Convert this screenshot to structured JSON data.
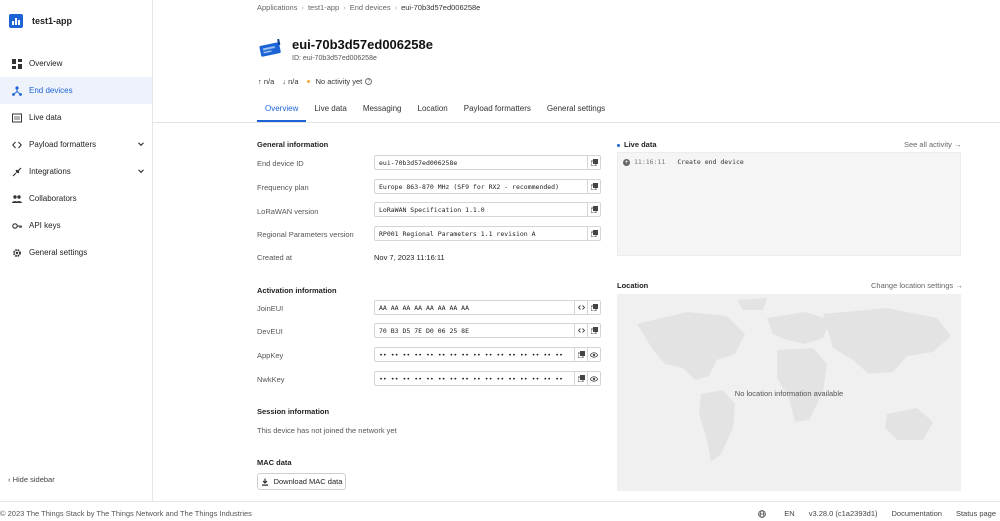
{
  "app": {
    "name": "test1-app"
  },
  "sidebar": {
    "items": [
      {
        "label": "Overview",
        "icon": "dashboard-icon"
      },
      {
        "label": "End devices",
        "icon": "device-hub-icon"
      },
      {
        "label": "Live data",
        "icon": "live-data-icon"
      },
      {
        "label": "Payload formatters",
        "icon": "code-icon"
      },
      {
        "label": "Integrations",
        "icon": "integrations-icon"
      },
      {
        "label": "Collaborators",
        "icon": "people-icon"
      },
      {
        "label": "API keys",
        "icon": "key-icon"
      },
      {
        "label": "General settings",
        "icon": "gear-icon"
      }
    ],
    "hide_label": "Hide sidebar"
  },
  "breadcrumb": [
    "Applications",
    "test1-app",
    "End devices",
    "eui-70b3d57ed006258e"
  ],
  "device": {
    "title": "eui-70b3d57ed006258e",
    "id_line": "ID: eui-70b3d57ed006258e",
    "uplink": "n/a",
    "downlink": "n/a",
    "activity": "No activity yet"
  },
  "tabs": [
    "Overview",
    "Live data",
    "Messaging",
    "Location",
    "Payload formatters",
    "General settings"
  ],
  "general": {
    "title": "General information",
    "end_device_id_label": "End device ID",
    "end_device_id": "eui-70b3d57ed006258e",
    "frequency_plan_label": "Frequency plan",
    "frequency_plan": "Europe 863-870 MHz (SF9 for RX2 - recommended)",
    "lorawan_version_label": "LoRaWAN version",
    "lorawan_version": "LoRaWAN Specification 1.1.0",
    "regional_label": "Regional Parameters version",
    "regional": "RP001 Regional Parameters 1.1 revision A",
    "created_label": "Created at",
    "created": "Nov 7, 2023 11:16:11"
  },
  "activation": {
    "title": "Activation information",
    "joineui_label": "JoinEUI",
    "joineui": "AA AA AA AA AA AA AA AA",
    "deveui_label": "DevEUI",
    "deveui": "70 B3 D5 7E D0 06 25 8E",
    "appkey_label": "AppKey",
    "appkey": "•• •• •• •• •• •• •• •• •• •• •• •• •• •• •• ••",
    "nwkkey_label": "NwkKey",
    "nwkkey": "•• •• •• •• •• •• •• •• •• •• •• •• •• •• •• ••"
  },
  "session": {
    "title": "Session information",
    "note": "This device has not joined the network yet"
  },
  "mac": {
    "title": "MAC data",
    "download_label": "Download MAC data"
  },
  "live": {
    "title": "Live data",
    "link": "See all activity →",
    "time": "11:16:11",
    "event": "Create end device"
  },
  "location": {
    "title": "Location",
    "link": "Change location settings →",
    "empty": "No location information available"
  },
  "footer": {
    "copyright": "© 2023 The Things Stack by The Things Network and The Things Industries",
    "lang": "EN",
    "version": "v3.28.0 (c1a2393d1)",
    "docs": "Documentation",
    "status": "Status page"
  },
  "colors": {
    "accent": "#1c63d6",
    "activity_dot": "#f4a83a"
  }
}
